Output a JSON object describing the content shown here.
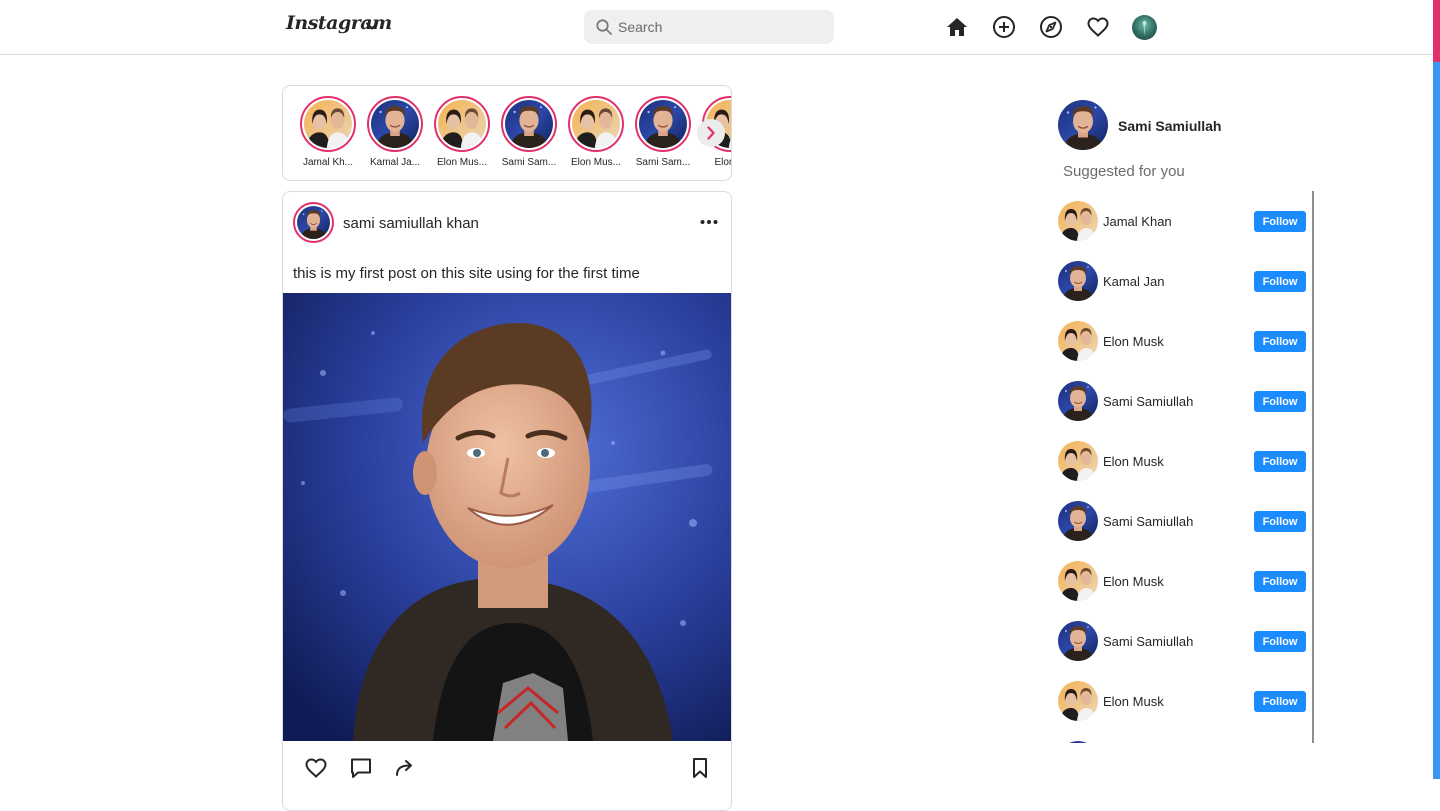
{
  "header": {
    "logo_text": "Instagram",
    "search": {
      "placeholder": "Search"
    },
    "nav_icons": [
      "home-icon",
      "add-post-icon",
      "explore-icon",
      "activity-heart-icon",
      "profile-avatar"
    ]
  },
  "stories": {
    "items": [
      {
        "name": "Jamal Khan",
        "photo": "couple-photo"
      },
      {
        "name": "Kamal Jan",
        "photo": "man-photo"
      },
      {
        "name": "Elon Musk",
        "photo": "couple-photo"
      },
      {
        "name": "Sami Samiullah",
        "photo": "man-photo"
      },
      {
        "name": "Elon Musk",
        "photo": "couple-photo"
      },
      {
        "name": "Sami Samiullah",
        "photo": "man-photo"
      },
      {
        "name": "Elon Musk",
        "photo": "couple-photo"
      }
    ],
    "display_names": [
      "Jamal Kh...",
      "Kamal Ja...",
      "Elon Mus...",
      "Sami Sam...",
      "Elon Mus...",
      "Sami Sam...",
      "Elon M"
    ]
  },
  "post": {
    "username": "sami samiullah khan",
    "caption": "this is my first post on this site using for the first time",
    "actions": [
      "like-icon",
      "comment-icon",
      "share-icon",
      "bookmark-icon"
    ]
  },
  "sidebar": {
    "current_user": "Sami Samiullah",
    "suggested_title": "Suggested for you",
    "follow_label": "Follow",
    "suggestions": [
      {
        "name": "Jamal Khan",
        "photo": "couple-photo"
      },
      {
        "name": "Kamal Jan",
        "photo": "man-photo"
      },
      {
        "name": "Elon Musk",
        "photo": "couple-photo"
      },
      {
        "name": "Sami Samiullah",
        "photo": "man-photo"
      },
      {
        "name": "Elon Musk",
        "photo": "couple-photo"
      },
      {
        "name": "Sami Samiullah",
        "photo": "man-photo"
      },
      {
        "name": "Elon Musk",
        "photo": "couple-photo"
      },
      {
        "name": "Sami Samiullah",
        "photo": "man-photo"
      },
      {
        "name": "Elon Musk",
        "photo": "couple-photo"
      }
    ]
  },
  "colors": {
    "accent": "#e1306c",
    "follow_button": "#1a8cff",
    "border": "#dbdbdb"
  }
}
